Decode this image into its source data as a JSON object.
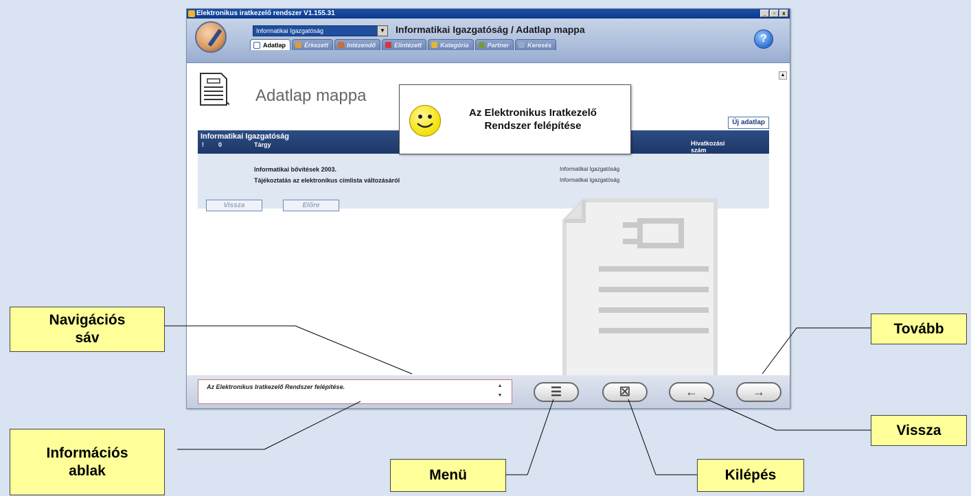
{
  "window": {
    "title": "Elektronikus iratkezelő rendszer V1.155.31",
    "controls": [
      "_",
      "▫",
      "x"
    ]
  },
  "header": {
    "department_select": "Informatikai Igazgatóság",
    "path_title": "Informatikai Igazgatóság / Adatlap mappa",
    "help_icon": "?"
  },
  "tabs": [
    {
      "label": "Adatlap",
      "icon": "folder-icon",
      "color": "#ffffff"
    },
    {
      "label": "Érkezett",
      "icon": "inbox-icon",
      "color": "#e09a3a"
    },
    {
      "label": "Intézendő",
      "icon": "task-icon",
      "color": "#cc6d3a"
    },
    {
      "label": "Elintézett",
      "icon": "done-icon",
      "color": "#d03a3a"
    },
    {
      "label": "Kategória",
      "icon": "category-icon",
      "color": "#e0b53a"
    },
    {
      "label": "Partner",
      "icon": "partner-icon",
      "color": "#7a9a3a"
    },
    {
      "label": "Keresés",
      "icon": "search-icon",
      "color": "#9aa8c8"
    }
  ],
  "page": {
    "heading": "Adatlap mappa",
    "new_button": "Új adatlap",
    "list_title": "Informatikai Igazgatóság",
    "columns": {
      "excl": "!",
      "attach": "0",
      "subject": "Tárgy",
      "reference_line1": "Hivatkozási",
      "reference_line2": "szám"
    },
    "rows": [
      {
        "subject": "Informatikai bővítések 2003.",
        "department": "Informatikai Igazgatóság"
      },
      {
        "subject": "Tájékoztatás az elektronikus címlista változásáról",
        "department": "Informatikai Igazgatóság"
      }
    ],
    "back_button": "Vissza",
    "forward_button": "Előre"
  },
  "popup": {
    "line1": "Az Elektronikus Iratkezelő",
    "line2": "Rendszer felépítése"
  },
  "bottombar": {
    "info_text": "Az Elektronikus Iratkezelő Rendszer felépítése.",
    "spin_up": "▲",
    "spin_down": "▼",
    "menu_glyph": "☰",
    "exit_glyph": "☒",
    "back_glyph": "←",
    "next_glyph": "→"
  },
  "callouts": {
    "nav": {
      "line1": "Navigációs",
      "line2": "sáv"
    },
    "info": {
      "line1": "Információs",
      "line2": "ablak"
    },
    "menu": "Menü",
    "exit": "Kilépés",
    "next": "Tovább",
    "back": "Vissza"
  }
}
